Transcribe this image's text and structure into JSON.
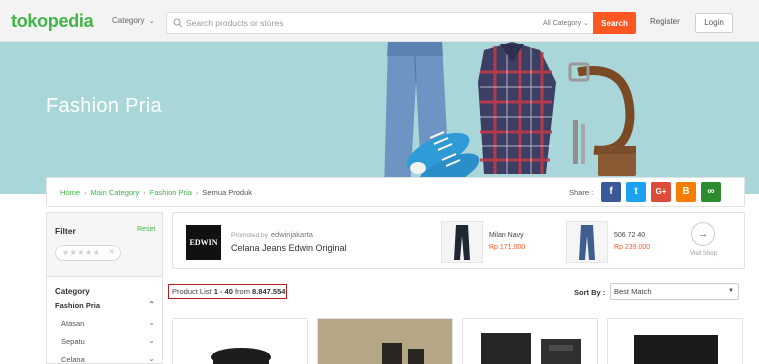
{
  "header": {
    "logo": "tokopedia",
    "category_label": "Category",
    "search": {
      "placeholder": "Search products or stores",
      "scope": "All Category",
      "button": "Search"
    },
    "register": "Register",
    "login": "Login"
  },
  "banner": {
    "title": "Fashion Pria"
  },
  "breadcrumb": {
    "items": [
      "Home",
      "Main Category",
      "Fashion Pria",
      "Semua Produk"
    ],
    "share_label": "Share :"
  },
  "share_buttons": [
    {
      "icon": "facebook-icon",
      "glyph": "f",
      "color": "#3b5998"
    },
    {
      "icon": "twitter-icon",
      "glyph": "t",
      "color": "#1da1f2"
    },
    {
      "icon": "google-plus-icon",
      "glyph": "G+",
      "color": "#dd4b39"
    },
    {
      "icon": "blogger-icon",
      "glyph": "B",
      "color": "#f57d00"
    },
    {
      "icon": "link-icon",
      "glyph": "∞",
      "color": "#2e8b2e"
    }
  ],
  "filter": {
    "title": "Filter",
    "reset": "Reset",
    "rating_stars": "★★★★★",
    "category_heading": "Category",
    "categories": [
      "Fashion Pria",
      "Atasan",
      "Sepatu",
      "Celana"
    ]
  },
  "promo": {
    "promoted_by": "Promoted by",
    "shop": "edwinjakarta",
    "logo_text": "EDWIN",
    "title": "Celana Jeans Edwin Original",
    "items": [
      {
        "name": "Milan Navy",
        "price": "Rp 171.000"
      },
      {
        "name": "506 72 40",
        "price": "Rp 239.000"
      }
    ],
    "visit": "Visit Shop"
  },
  "product_list": {
    "prefix": "Product List ",
    "range": "1 - 40",
    "from": " from ",
    "total": "8.847.554",
    "sort_label": "Sort By :",
    "sort_value": "Best Match"
  },
  "colors": {
    "brand_green": "#42b549",
    "search_orange": "#ff5722",
    "banner_teal": "#a9d6d8",
    "highlight_red": "#b91c1c"
  }
}
